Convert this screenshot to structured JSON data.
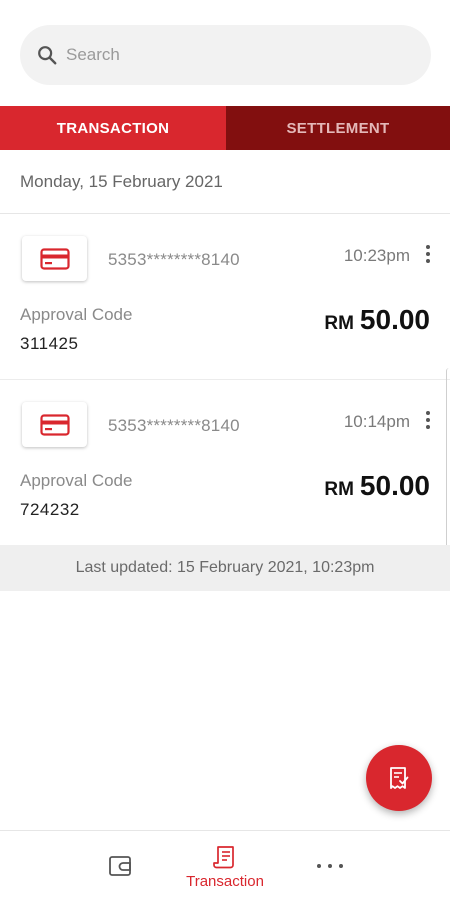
{
  "search": {
    "placeholder": "Search"
  },
  "tabs": [
    {
      "label": "TRANSACTION",
      "active": true
    },
    {
      "label": "SETTLEMENT",
      "active": false
    }
  ],
  "date_header": "Monday, 15 February 2021",
  "transactions": [
    {
      "card_number": "5353********8140",
      "time": "10:23pm",
      "approval_label": "Approval Code",
      "approval_code": "311425",
      "currency": "RM",
      "amount": "50.00"
    },
    {
      "card_number": "5353********8140",
      "time": "10:14pm",
      "approval_label": "Approval Code",
      "approval_code": "724232",
      "currency": "RM",
      "amount": "50.00"
    }
  ],
  "last_updated": "Last updated: 15 February 2021, 10:23pm",
  "bottom_nav": {
    "items": [
      {
        "icon": "wallet-icon",
        "label": ""
      },
      {
        "icon": "receipt-icon",
        "label": "Transaction",
        "active": true
      },
      {
        "icon": "more-horizontal-icon",
        "label": ""
      }
    ]
  },
  "fab": {
    "icon": "receipt-check-icon"
  },
  "colors": {
    "accent": "#d9272e",
    "tab_inactive": "#820f0f"
  }
}
